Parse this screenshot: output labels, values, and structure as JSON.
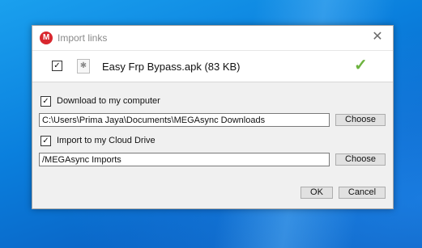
{
  "dialog": {
    "title": "Import links",
    "logo": "M",
    "close_glyph": "✕"
  },
  "file": {
    "checked_glyph": "✓",
    "name": "Easy Frp Bypass.apk (83 KB)",
    "icon": "settings-file-icon",
    "status_glyph": "✓",
    "status_color": "#6db33f"
  },
  "download": {
    "label": "Download to my computer",
    "checked_glyph": "✓",
    "path": "C:\\Users\\Prima Jaya\\Documents\\MEGAsync Downloads",
    "choose_label": "Choose"
  },
  "cloud": {
    "label": "Import to my Cloud Drive",
    "checked_glyph": "✓",
    "path": "/MEGAsync Imports",
    "choose_label": "Choose"
  },
  "actions": {
    "ok_label": "OK",
    "cancel_label": "Cancel"
  }
}
